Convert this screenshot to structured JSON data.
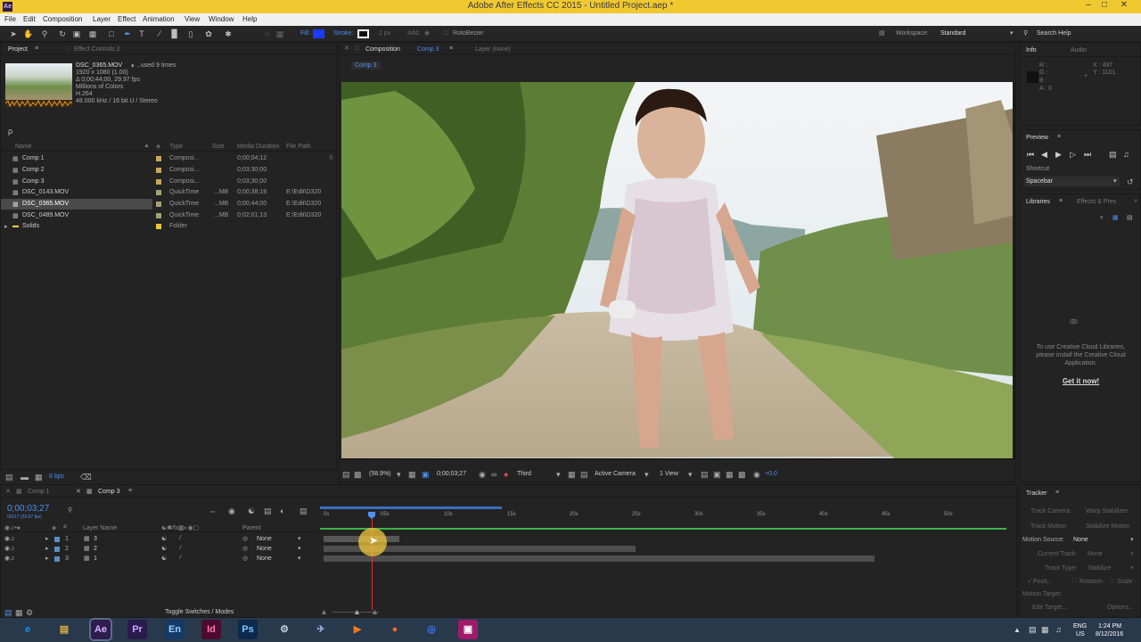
{
  "app": {
    "title": "Adobe After Effects CC 2015 - Untitled Project.aep *",
    "icon_text": "Ae"
  },
  "menu": [
    "File",
    "Edit",
    "Composition",
    "Layer",
    "Effect",
    "Animation",
    "View",
    "Window",
    "Help"
  ],
  "toolbar": {
    "fill_label": "Fill:",
    "stroke_label": "Stroke:",
    "stroke_size": "2 px",
    "add_label": "Add:",
    "rotobezier_label": "RotoBezier",
    "workspace_label": "Workspace:",
    "workspace_value": "Standard",
    "search_help": "Search Help",
    "fill_color": "#1a3cff"
  },
  "project_panel": {
    "tab_project": "Project",
    "tab_effect_controls": "Effect Controls 2",
    "item_name": "DSC_0365.MOV",
    "item_used": ", used 9 times",
    "info_lines": [
      "1920 x 1080 (1.00)",
      "Δ 0;00;44;00, 29.97 fps",
      "Millions of Colors",
      "H.264",
      "48.000 kHz / 16 bit U / Stereo"
    ],
    "search_placeholder": "ρ",
    "columns": {
      "name": "Name",
      "type": "Type",
      "size": "Size",
      "duration": "Media Duration",
      "path": "File Path"
    },
    "items": [
      {
        "name": "Comp 1",
        "type": "Composi...",
        "size": "",
        "duration": "0;00;04;12",
        "path": "",
        "color": "#c9a55a"
      },
      {
        "name": "Comp 2",
        "type": "Composi...",
        "size": "",
        "duration": "0;03;30;00",
        "path": "",
        "color": "#c9a55a"
      },
      {
        "name": "Comp 3",
        "type": "Composi...",
        "size": "",
        "duration": "0;03;30;00",
        "path": "",
        "color": "#c9a55a"
      },
      {
        "name": "DSC_0143.MOV",
        "type": "QuickTime",
        "size": "...MB",
        "duration": "0;00;38;18",
        "path": "E:\\Edit\\D320",
        "color": "#a7a070"
      },
      {
        "name": "DSC_0365.MOV",
        "type": "QuickTime",
        "size": "...MB",
        "duration": "0;00;44;00",
        "path": "E:\\Edit\\D320",
        "color": "#a7a070"
      },
      {
        "name": "DSC_0489.MOV",
        "type": "QuickTime",
        "size": "...MB",
        "duration": "0;02;01;13",
        "path": "E:\\Edit\\D320",
        "color": "#a7a070"
      },
      {
        "name": "Solids",
        "type": "Folder",
        "size": "",
        "duration": "",
        "path": "",
        "color": "#e8c83a"
      }
    ],
    "bpc": "8 bpc"
  },
  "composition_panel": {
    "tab_label": "Composition",
    "tab_comp": "Comp 3",
    "layer_tab": "Layer (none)",
    "subtab": "Comp 3",
    "zoom": "(58.9%)",
    "timecode": "0;00;03;27",
    "resolution": "Third",
    "camera": "Active Camera",
    "views": "1 View",
    "exposure": "+0.0"
  },
  "info_panel": {
    "tab_info": "Info",
    "tab_audio": "Audio",
    "r": "R :",
    "g": "G :",
    "b": "B :",
    "a": "A : 0",
    "x": "X : 497",
    "y": "Y : 1101"
  },
  "preview_panel": {
    "title": "Preview",
    "shortcut_label": "Shortcut",
    "shortcut_value": "Spacebar"
  },
  "libraries_panel": {
    "tab": "Libraries",
    "tab2": "Effects & Pres",
    "message": "To use Creative Cloud Libraries, please install the Creative Cloud Application.",
    "cta": "Get it now!"
  },
  "tracker_panel": {
    "title": "Tracker",
    "track_camera": "Track Camera",
    "warp_stabilizer": "Warp Stabilizer",
    "track_motion": "Track Motion",
    "stabilize_motion": "Stabilize Motion",
    "motion_source_label": "Motion Source:",
    "motion_source_value": "None",
    "current_track_label": "Current Track:",
    "current_track_value": "None",
    "track_type_label": "Track Type:",
    "track_type_value": "Stabilize",
    "position": "Posit...",
    "rotation": "Rotation",
    "scale": "Scale",
    "motion_target": "Motion Target:",
    "edit_target": "Edit Target...",
    "options": "Options..."
  },
  "timeline": {
    "tabs": [
      "Comp 1",
      "Comp 3"
    ],
    "timecode": "0;00;03;27",
    "frame_info": "00117 (29.97 fps)",
    "col_layer_name": "Layer Name",
    "col_parent": "Parent",
    "ruler": [
      "0s",
      "05s",
      "10s",
      "15s",
      "20s",
      "25s",
      "30s",
      "35s",
      "40s",
      "45s",
      "50s"
    ],
    "layers": [
      {
        "num": "1",
        "name": "3",
        "parent": "None"
      },
      {
        "num": "2",
        "name": "2",
        "parent": "None"
      },
      {
        "num": "3",
        "name": "1",
        "parent": "None"
      }
    ],
    "toggle_label": "Toggle Switches / Modes"
  },
  "taskbar": {
    "apps": [
      {
        "label": "e",
        "color": "#1f8fe0",
        "name": "ie"
      },
      {
        "label": "▤",
        "color": "#e0b040",
        "name": "explorer"
      },
      {
        "label": "Ae",
        "color": "#2d1c4d",
        "name": "after-effects"
      },
      {
        "label": "Pr",
        "color": "#2a1b4d",
        "name": "premiere"
      },
      {
        "label": "En",
        "color": "#143a66",
        "name": "encore"
      },
      {
        "label": "Id",
        "color": "#4d0c2e",
        "name": "indesign"
      },
      {
        "label": "Ps",
        "color": "#0c2a4d",
        "name": "photoshop"
      },
      {
        "label": "⚙",
        "color": "#3a5a7a",
        "name": "tool"
      },
      {
        "label": "✈",
        "color": "#3a5a7a",
        "name": "app"
      },
      {
        "label": "▶",
        "color": "#d06a1a",
        "name": "player"
      },
      {
        "label": "●",
        "color": "#e05a1a",
        "name": "firefox"
      },
      {
        "label": "◎",
        "color": "#1a4ab0",
        "name": "app2"
      },
      {
        "label": "▣",
        "color": "#a01a6a",
        "name": "app3"
      }
    ],
    "lang": "ENG",
    "region": "US",
    "time": "1:24 PM",
    "date": "8/12/2016"
  }
}
